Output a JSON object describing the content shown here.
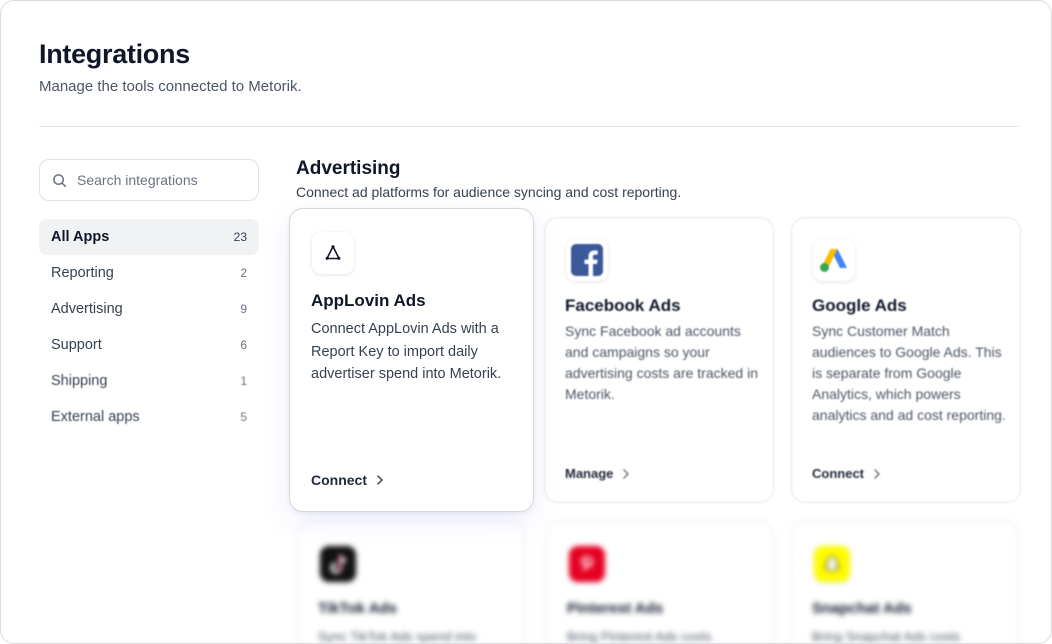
{
  "header": {
    "title": "Integrations",
    "subtitle": "Manage the tools connected to Metorik."
  },
  "search": {
    "placeholder": "Search integrations",
    "icon": "search-icon"
  },
  "nav": [
    {
      "label": "All Apps",
      "count": "23",
      "active": true
    },
    {
      "label": "Reporting",
      "count": "2"
    },
    {
      "label": "Advertising",
      "count": "9"
    },
    {
      "label": "Support",
      "count": "6"
    },
    {
      "label": "Shipping",
      "count": "1"
    },
    {
      "label": "External apps",
      "count": "5"
    }
  ],
  "section": {
    "title": "Advertising",
    "subtitle": "Connect ad platforms for audience syncing and cost reporting."
  },
  "cards": {
    "applovin": {
      "name": "AppLovin Ads",
      "description": "Connect AppLovin Ads with a Report Key to import daily advertiser spend into Metorik.",
      "action": "Connect",
      "icon": "applovin-logo-icon"
    },
    "facebook": {
      "name": "Facebook Ads",
      "description": "Sync Facebook ad accounts and campaigns so your advertising costs are tracked in Metorik.",
      "action": "Manage",
      "icon": "facebook-logo-icon",
      "color": "#3b5998"
    },
    "google": {
      "name": "Google Ads",
      "description": "Sync Customer Match audiences to Google Ads. This is separate from Google Analytics, which powers analytics and ad cost reporting.",
      "action": "Connect",
      "icon": "google-ads-logo-icon"
    },
    "tiktok": {
      "name": "TikTok Ads",
      "description": "Sync TikTok Ads spend into",
      "icon": "tiktok-logo-icon"
    },
    "pinterest": {
      "name": "Pinterest Ads",
      "description": "Bring Pinterest Ads costs",
      "icon": "pinterest-logo-icon",
      "color": "#e60023"
    },
    "snapchat": {
      "name": "Snapchat Ads",
      "description": "Bring Snapchat Ads costs",
      "icon": "snapchat-logo-icon",
      "color": "#fffc00"
    }
  }
}
